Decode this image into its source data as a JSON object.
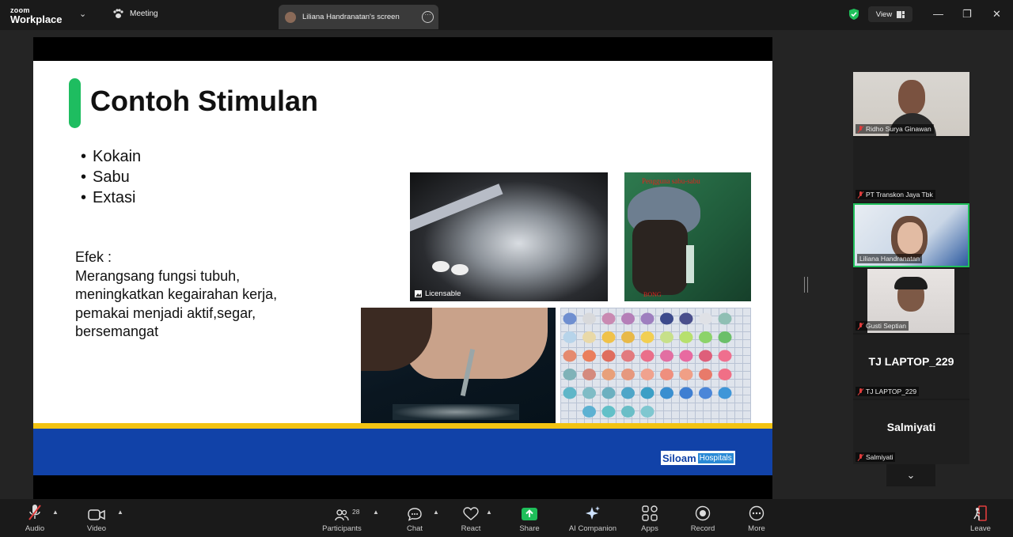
{
  "app": {
    "brand_top": "zoom",
    "brand_bottom": "Workplace"
  },
  "tabs": {
    "meeting": "Meeting",
    "screen": "Liliana Handranatan's screen"
  },
  "header": {
    "view_label": "View"
  },
  "slide": {
    "title": "Contoh Stimulan",
    "bullets": [
      "Kokain",
      "Sabu",
      "Extasi"
    ],
    "effect_lines": [
      "Efek :",
      "Merangsang fungsi tubuh,",
      "meningkatkan kegairahan kerja,",
      "pemakai menjadi aktif,segar,",
      "bersemangat"
    ],
    "image_badge": "Licensable",
    "photo_caption_top": "Pengguna sabu-sabu",
    "photo_caption_bottom": "BONG",
    "logo_primary": "Siloam",
    "logo_secondary": "Hospitals"
  },
  "participants": [
    {
      "name": "Ridho Surya Ginawan",
      "muted": true,
      "video": true
    },
    {
      "name": "PT Transkon Jaya Tbk",
      "muted": true,
      "video": false
    },
    {
      "name": "Liliana Handranatan",
      "muted": false,
      "video": true,
      "active_speaker": true
    },
    {
      "name": "Gusti Septian",
      "muted": true,
      "video": true
    },
    {
      "name": "TJ LAPTOP_229",
      "display": "TJ LAPTOP_229",
      "muted": true,
      "video": false
    },
    {
      "name": "Salmiyati",
      "display": "Salmiyati",
      "muted": true,
      "video": false
    }
  ],
  "toolbar": {
    "audio": "Audio",
    "video": "Video",
    "participants": "Participants",
    "participants_count": "28",
    "chat": "Chat",
    "react": "React",
    "share": "Share",
    "ai": "AI Companion",
    "apps": "Apps",
    "record": "Record",
    "more": "More",
    "leave": "Leave"
  },
  "colors": {
    "accent_green": "#1ebd60",
    "share_green": "#1fbf5a",
    "leave_red": "#e03c3c",
    "slide_blue": "#1142a8",
    "slide_yellow": "#f2c312"
  }
}
